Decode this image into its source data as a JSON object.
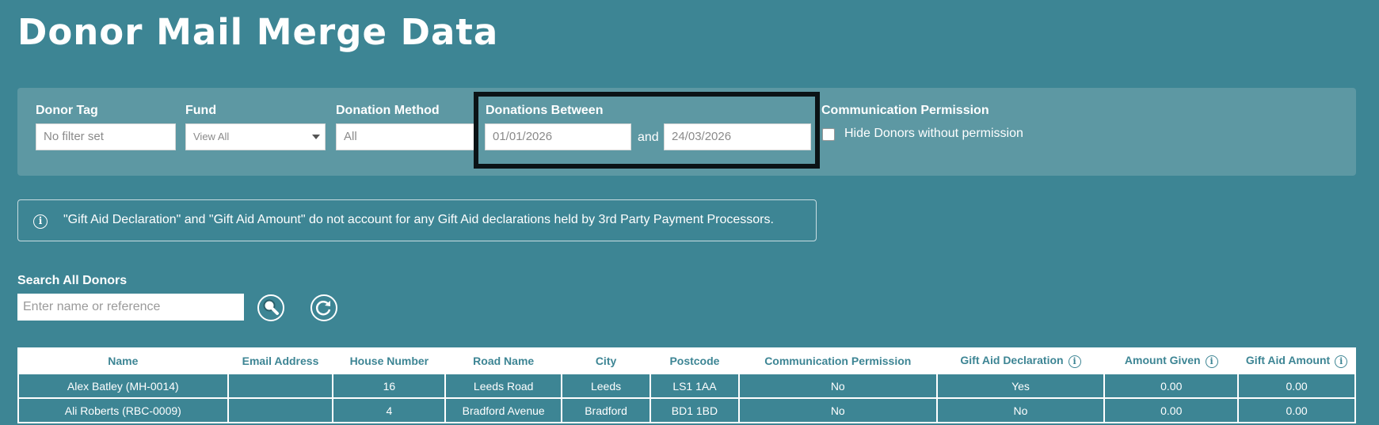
{
  "page": {
    "title": "Donor Mail Merge Data"
  },
  "filters": {
    "donor_tag": {
      "label": "Donor Tag",
      "placeholder": "No filter set"
    },
    "fund": {
      "label": "Fund",
      "value": "View All"
    },
    "donation_method": {
      "label": "Donation Method",
      "value": "All"
    },
    "donations_between": {
      "label": "Donations Between",
      "from": "01/01/2026",
      "and_label": "and",
      "to": "24/03/2026"
    },
    "communication_permission": {
      "label": "Communication Permission",
      "checkbox_label": "Hide Donors without permission",
      "checked": false
    }
  },
  "notice": {
    "icon": "info-icon",
    "text": "\"Gift Aid Declaration\" and \"Gift Aid Amount\" do not account for any Gift Aid declarations held by 3rd Party Payment Processors."
  },
  "search": {
    "label": "Search All Donors",
    "placeholder": "Enter name or reference",
    "search_icon": "magnifier-icon",
    "reset_icon": "refresh-icon"
  },
  "table": {
    "headers": [
      "Name",
      "Email Address",
      "House Number",
      "Road Name",
      "City",
      "Postcode",
      "Communication Permission",
      "Gift Aid Declaration",
      "Amount Given",
      "Gift Aid Amount"
    ],
    "rows": [
      [
        "Alex Batley (MH-0014)",
        "",
        "16",
        "Leeds Road",
        "Leeds",
        "LS1 1AA",
        "No",
        "Yes",
        "0.00",
        "0.00"
      ],
      [
        "Ali Roberts (RBC-0009)",
        "",
        "4",
        "Bradford Avenue",
        "Bradford",
        "BD1 1BD",
        "No",
        "No",
        "0.00",
        "0.00"
      ]
    ]
  },
  "colors": {
    "background": "#3d8594",
    "panel": "#5d98a3",
    "highlight_border": "#0b1316"
  }
}
